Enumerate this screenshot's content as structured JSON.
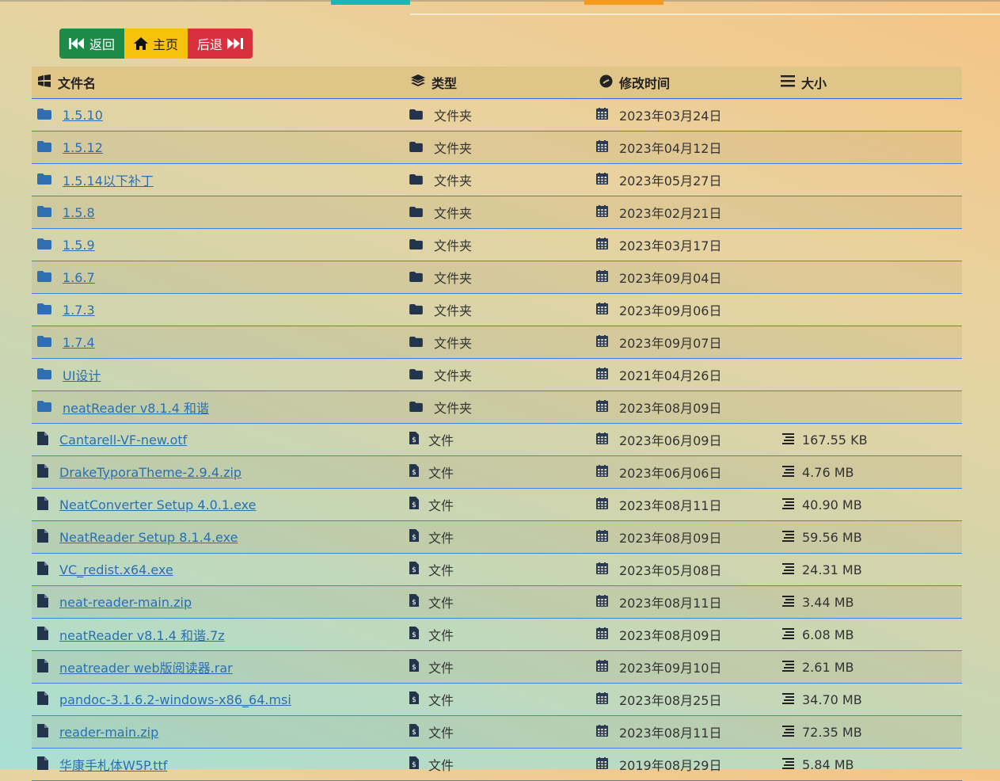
{
  "nav": {
    "back_label": "返回",
    "home_label": "主页",
    "forward_label": "后退"
  },
  "header": {
    "name": "文件名",
    "type": "类型",
    "modified": "修改时间",
    "size": "大小"
  },
  "colors": {
    "back": "#1e8a4a",
    "home": "#f6c20b",
    "forward": "#d9303f",
    "link": "#2a6fb4",
    "divider": "#3b82e6"
  },
  "rows": [
    {
      "name": "1.5.10",
      "type": "文件夹",
      "kind": "folder",
      "date": "2023年03月24日",
      "size": ""
    },
    {
      "name": "1.5.12",
      "type": "文件夹",
      "kind": "folder",
      "date": "2023年04月12日",
      "size": ""
    },
    {
      "name": "1.5.14以下补丁",
      "type": "文件夹",
      "kind": "folder",
      "date": "2023年05月27日",
      "size": ""
    },
    {
      "name": "1.5.8",
      "type": "文件夹",
      "kind": "folder",
      "date": "2023年02月21日",
      "size": ""
    },
    {
      "name": "1.5.9",
      "type": "文件夹",
      "kind": "folder",
      "date": "2023年03月17日",
      "size": ""
    },
    {
      "name": "1.6.7",
      "type": "文件夹",
      "kind": "folder",
      "date": "2023年09月04日",
      "size": ""
    },
    {
      "name": "1.7.3",
      "type": "文件夹",
      "kind": "folder",
      "date": "2023年09月06日",
      "size": ""
    },
    {
      "name": "1.7.4",
      "type": "文件夹",
      "kind": "folder",
      "date": "2023年09月07日",
      "size": ""
    },
    {
      "name": "UI设计",
      "type": "文件夹",
      "kind": "folder",
      "date": "2021年04月26日",
      "size": ""
    },
    {
      "name": "neatReader v8.1.4 和谐",
      "type": "文件夹",
      "kind": "folder",
      "date": "2023年08月09日",
      "size": ""
    },
    {
      "name": "Cantarell-VF-new.otf",
      "type": "文件",
      "kind": "file",
      "date": "2023年06月09日",
      "size": "167.55 KB"
    },
    {
      "name": "DrakeTyporaTheme-2.9.4.zip",
      "type": "文件",
      "kind": "file",
      "date": "2023年06月06日",
      "size": "4.76 MB"
    },
    {
      "name": "NeatConverter Setup 4.0.1.exe",
      "type": "文件",
      "kind": "file",
      "date": "2023年08月11日",
      "size": "40.90 MB"
    },
    {
      "name": "NeatReader Setup 8.1.4.exe",
      "type": "文件",
      "kind": "file",
      "date": "2023年08月09日",
      "size": "59.56 MB"
    },
    {
      "name": "VC_redist.x64.exe",
      "type": "文件",
      "kind": "file",
      "date": "2023年05月08日",
      "size": "24.31 MB"
    },
    {
      "name": "neat-reader-main.zip",
      "type": "文件",
      "kind": "file",
      "date": "2023年08月11日",
      "size": "3.44 MB"
    },
    {
      "name": "neatReader v8.1.4 和谐.7z",
      "type": "文件",
      "kind": "file",
      "date": "2023年08月09日",
      "size": "6.08 MB"
    },
    {
      "name": "neatreader web版阅读器.rar",
      "type": "文件",
      "kind": "file",
      "date": "2023年09月10日",
      "size": "2.61 MB"
    },
    {
      "name": "pandoc-3.1.6.2-windows-x86_64.msi",
      "type": "文件",
      "kind": "file",
      "date": "2023年08月25日",
      "size": "34.70 MB"
    },
    {
      "name": "reader-main.zip",
      "type": "文件",
      "kind": "file",
      "date": "2023年08月11日",
      "size": "72.35 MB"
    },
    {
      "name": "华康手札体W5P.ttf",
      "type": "文件",
      "kind": "file",
      "date": "2019年08月29日",
      "size": "5.84 MB"
    }
  ]
}
